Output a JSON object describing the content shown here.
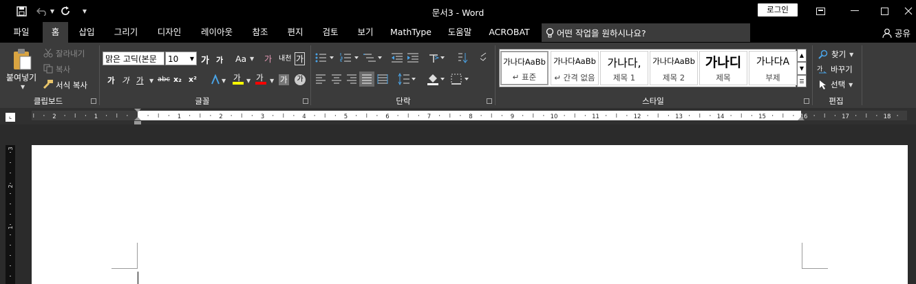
{
  "window": {
    "title": "문서3  -  Word",
    "login_label": "로그인"
  },
  "quick_access": {
    "icons": [
      "save-icon",
      "undo-icon",
      "redo-icon",
      "customize-icon"
    ]
  },
  "tabs": [
    {
      "label": "파일",
      "active": false
    },
    {
      "label": "홈",
      "active": true
    },
    {
      "label": "삽입",
      "active": false
    },
    {
      "label": "그리기",
      "active": false
    },
    {
      "label": "디자인",
      "active": false
    },
    {
      "label": "레이아웃",
      "active": false
    },
    {
      "label": "참조",
      "active": false
    },
    {
      "label": "편지",
      "active": false
    },
    {
      "label": "검토",
      "active": false
    },
    {
      "label": "보기",
      "active": false
    },
    {
      "label": "MathType",
      "active": false
    },
    {
      "label": "도움말",
      "active": false
    },
    {
      "label": "ACROBAT",
      "active": false
    }
  ],
  "tell_me": {
    "placeholder": "어떤 작업을 원하시나요?"
  },
  "share": {
    "label": "공유"
  },
  "clipboard": {
    "group_label": "클립보드",
    "paste": "붙여넣기",
    "cut": "잘라내기",
    "copy": "복사",
    "format_painter": "서식 복사"
  },
  "font": {
    "group_label": "글꼴",
    "font_name": "맑은 고딕(본문",
    "font_size": "10",
    "grow": "가",
    "shrink": "가",
    "change_case": "Aa",
    "clear": "가",
    "phonetic": "내천",
    "border": "가",
    "bold": "가",
    "italic": "가",
    "underline": "가",
    "strike": "abc",
    "sub": "x₂",
    "sup": "x²",
    "highlight": "가",
    "font_color": "가",
    "shading": "가",
    "enclose": "가"
  },
  "paragraph": {
    "group_label": "단락"
  },
  "styles": {
    "group_label": "스타일",
    "items": [
      {
        "preview": "가나다AaBb",
        "name": "↵ 표준",
        "selected": true
      },
      {
        "preview": "가나다AaBb",
        "name": "↵ 간격 없음",
        "selected": false
      },
      {
        "preview": "가나다,",
        "name": "제목 1",
        "selected": false
      },
      {
        "preview": "가나다AaBb",
        "name": "제목 2",
        "selected": false
      },
      {
        "preview": "가나디",
        "name": "제목",
        "selected": false
      },
      {
        "preview": "가나다A",
        "name": "부제",
        "selected": false
      }
    ]
  },
  "editing": {
    "group_label": "편집",
    "find": "찾기",
    "replace": "바꾸기",
    "select": "선택"
  },
  "ruler": {
    "h_numbers": [
      "2",
      "1",
      "1",
      "2",
      "3",
      "4",
      "5",
      "6",
      "7",
      "8",
      "9",
      "10",
      "11",
      "12",
      "13",
      "14",
      "15",
      "16",
      "17",
      "18"
    ],
    "v_numbers": [
      "3",
      "2",
      "1"
    ]
  },
  "colors": {
    "title_bg": "#000000",
    "ribbon_bg": "#3b3b3b",
    "highlight_yellow": "#ffff00",
    "font_red": "#ff0000"
  }
}
